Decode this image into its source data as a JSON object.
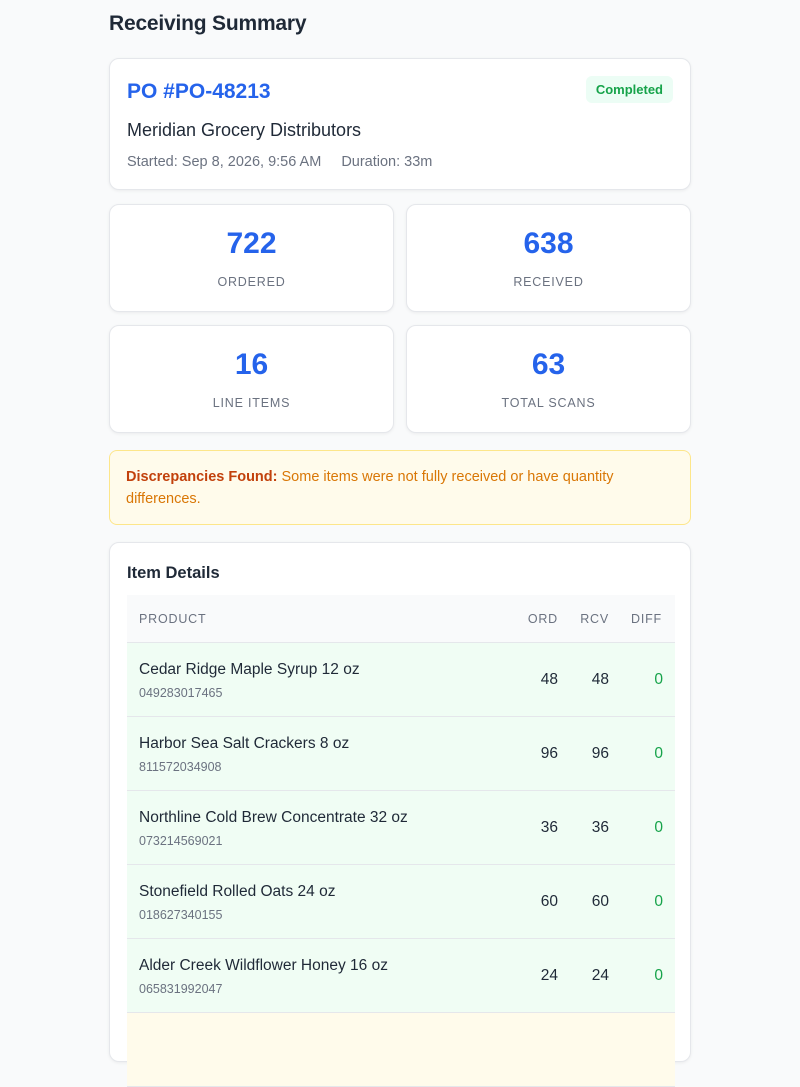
{
  "page": {
    "title": "Receiving Summary"
  },
  "po": {
    "number": "PO #PO-48213",
    "status": "Completed",
    "vendor": "Meridian Grocery Distributors",
    "started": "Started: Sep 8, 2026, 9:56 AM",
    "duration": "Duration: 33m"
  },
  "stats": {
    "ordered": {
      "value": "722",
      "label": "ORDERED"
    },
    "received": {
      "value": "638",
      "label": "RECEIVED"
    },
    "line_items": {
      "value": "16",
      "label": "LINE ITEMS"
    },
    "total_scans": {
      "value": "63",
      "label": "TOTAL SCANS"
    }
  },
  "alert": {
    "title": "Discrepancies Found:",
    "message": " Some items were not fully received or have quantity differences."
  },
  "details": {
    "title": "Item Details",
    "columns": {
      "product": "PRODUCT",
      "ord": "ORD",
      "rcv": "RCV",
      "diff": "DIFF"
    },
    "rows": [
      {
        "name": "Cedar Ridge Maple Syrup 12 oz",
        "sku": "049283017465",
        "ord": "48",
        "rcv": "48",
        "diff": "0"
      },
      {
        "name": "Harbor Sea Salt Crackers 8 oz",
        "sku": "811572034908",
        "ord": "96",
        "rcv": "96",
        "diff": "0"
      },
      {
        "name": "Northline Cold Brew Concentrate 32 oz",
        "sku": "073214569021",
        "ord": "36",
        "rcv": "36",
        "diff": "0"
      },
      {
        "name": "Stonefield Rolled Oats 24 oz",
        "sku": "018627340155",
        "ord": "60",
        "rcv": "60",
        "diff": "0"
      },
      {
        "name": "Alder Creek Wildflower Honey 16 oz",
        "sku": "065831992047",
        "ord": "24",
        "rcv": "24",
        "diff": "0"
      }
    ]
  },
  "colors": {
    "accent": "#2563eb",
    "success": "#16a34a",
    "warning": "#d97706",
    "row_ok_bg": "#f0fdf4",
    "row_warn_bg": "#fffbeb"
  }
}
